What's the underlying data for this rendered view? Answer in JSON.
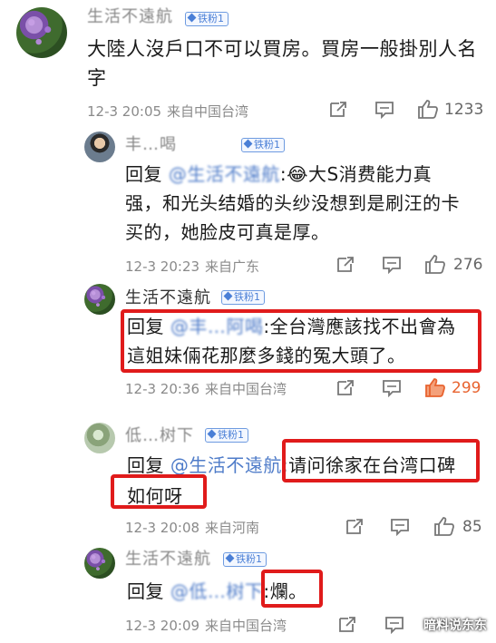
{
  "comments": [
    {
      "username": "生活不遠航",
      "badge": "铁粉1",
      "text": "大陸人沒戶口不可以買房。買房一般掛別人名字",
      "time": "12-3 20:05",
      "location": "来自中国台湾",
      "likes": "1233"
    },
    {
      "username": "丰…喝",
      "badge": "铁粉1",
      "reply_prefix": "回复",
      "mention": "@生活不遠航",
      "text": ":😂大S消费能力真强，和光头结婚的头纱没想到是刷汪的卡买的，她脸皮可真是厚。",
      "time": "12-3 20:23",
      "location": "来自广东",
      "likes": "276"
    },
    {
      "username": "生活不遠航",
      "badge": "铁粉1",
      "reply_prefix": "回复",
      "mention": "@丰…阿喝",
      "text": ":全台灣應該找不出會為這姐妹倆花那麼多錢的冤大頭了。",
      "time": "12-3 20:36",
      "location": "来自中国台湾",
      "likes": "299"
    },
    {
      "username": "低…树下",
      "badge": "铁粉1",
      "reply_prefix": "回复",
      "mention": "@生活不遠航",
      "text": ":请问徐家在台湾口碑如何呀",
      "time": "12-3 20:08",
      "location": "来自河南",
      "likes": "85"
    },
    {
      "username": "生活不遠航",
      "badge": "铁粉1",
      "reply_prefix": "回复",
      "mention": "@低…树下",
      "text": ":爛。",
      "time": "12-3 20:09",
      "location": "来自中国台湾",
      "likes": ""
    }
  ],
  "watermark": "暗料说东东",
  "colors": {
    "highlight_box": "#e01b1b",
    "mention": "#4f7cc9",
    "hot_like": "#e8632f"
  },
  "icons": [
    "share-icon",
    "comment-icon",
    "like-icon"
  ]
}
